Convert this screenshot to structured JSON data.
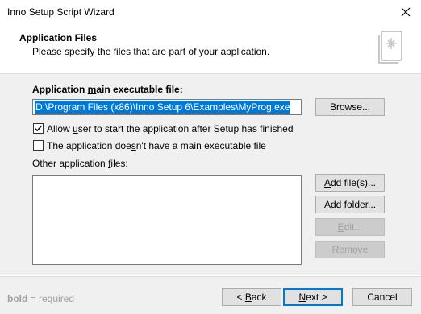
{
  "window": {
    "title": "Inno Setup Script Wizard"
  },
  "header": {
    "title": "Application Files",
    "description": "Please specify the files that are part of your application."
  },
  "main_exe": {
    "label_pre": "Application ",
    "label_ul": "m",
    "label_post": "ain executable file:",
    "value": "D:\\Program Files (x86)\\Inno Setup 6\\Examples\\MyProg.exe",
    "browse_label": "Browse..."
  },
  "options": {
    "allow_user": {
      "pre": "Allow ",
      "ul": "u",
      "post": "ser to start the application after Setup has finished",
      "checked": true
    },
    "no_exe": {
      "pre": "The application doe",
      "ul": "s",
      "post": "n't have a main executable file",
      "checked": false
    }
  },
  "other_files": {
    "label_pre": "Other application ",
    "label_ul": "f",
    "label_post": "iles:",
    "buttons": {
      "add_files": {
        "ul": "A",
        "post": "dd file(s)..."
      },
      "add_folder": {
        "pre": "Add fol",
        "ul": "d",
        "post": "er..."
      },
      "edit": {
        "ul": "E",
        "post": "dit..."
      },
      "remove": {
        "pre": "Remo",
        "ul": "v",
        "post": "e"
      }
    }
  },
  "footer": {
    "hint_bold": "bold",
    "hint_rest": " = required",
    "back": {
      "pre": "< ",
      "ul": "B",
      "post": "ack"
    },
    "next": {
      "ul": "N",
      "post": "ext >"
    },
    "cancel": "Cancel"
  }
}
